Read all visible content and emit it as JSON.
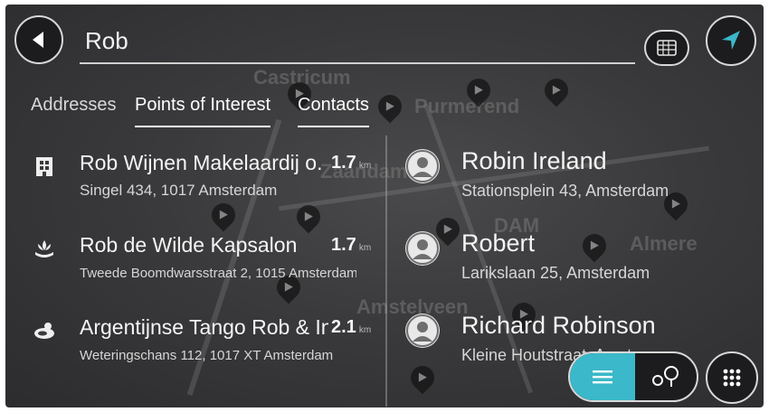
{
  "search": {
    "value": "Rob",
    "placeholder": ""
  },
  "tabs": [
    {
      "label": "Addresses",
      "active": false
    },
    {
      "label": "Points of Interest",
      "active": true
    },
    {
      "label": "Contacts",
      "active": true
    }
  ],
  "poi_results": [
    {
      "icon": "building-icon",
      "title": "Rob Wijnen Makelaardij o.",
      "distance": "1.7",
      "unit": "km",
      "address": "Singel 434, 1017 Amsterdam"
    },
    {
      "icon": "salon-icon",
      "title": "Rob de Wilde Kapsalon",
      "distance": "1.7",
      "unit": "km",
      "address": "Tweede Boomdwarsstraat 2, 1015 Amsterdam"
    },
    {
      "icon": "dance-icon",
      "title": "Argentijnse Tango Rob & Ing",
      "distance": "2.1",
      "unit": "km",
      "address": "Weteringschans 112, 1017 XT Amsterdam"
    }
  ],
  "contact_results": [
    {
      "name": "Robin Ireland",
      "address": "Stationsplein 43, Amsterdam"
    },
    {
      "name": "Robert",
      "address": "Larikslaan 25, Amsterdam"
    },
    {
      "name": "Richard Robinson",
      "address": "Kleine Houtstraat, Amsterdam"
    }
  ],
  "map_labels": [
    "Castricum",
    "Purmerend",
    "Zaandam",
    "Almere",
    "Amstelveen",
    "DAM"
  ],
  "colors": {
    "accent": "#3bb8c9",
    "background": "#3a3a3c",
    "text": "#f5f5f5"
  }
}
